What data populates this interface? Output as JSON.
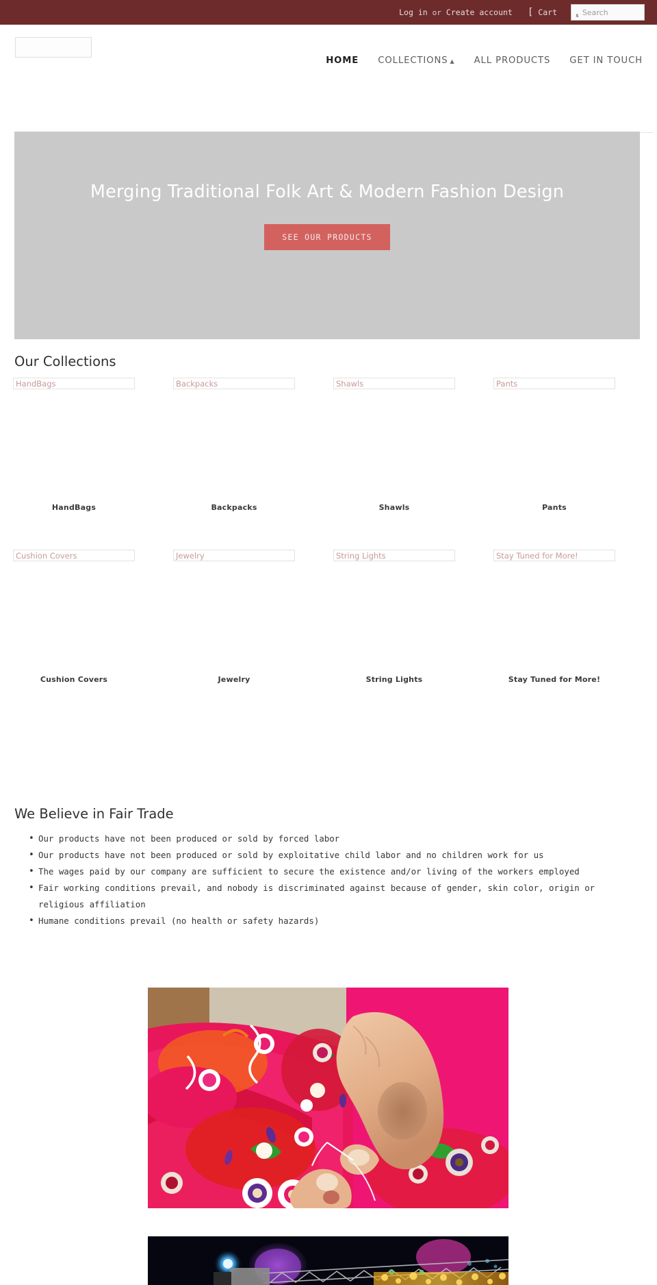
{
  "topbar": {
    "login_label": "Log in",
    "or_label": "or",
    "create_account_label": "Create account",
    "cart_icon": "cart-icon",
    "cart_glyph": "[",
    "cart_label": "Cart",
    "search_glyph": "s",
    "search_placeholder": "Search",
    "search_value": "",
    "background_color": "#6e2b2b"
  },
  "header": {
    "logo_alt": "",
    "nav": [
      {
        "label": "HOME",
        "active": true,
        "has_dropdown": false
      },
      {
        "label": "COLLECTIONS",
        "active": false,
        "has_dropdown": true,
        "caret": "▲"
      },
      {
        "label": "ALL PRODUCTS",
        "active": false,
        "has_dropdown": false
      },
      {
        "label": "GET IN TOUCH",
        "active": false,
        "has_dropdown": false
      }
    ]
  },
  "hero": {
    "title": "Merging Traditional Folk Art & Modern Fashion Design",
    "button_label": "SEE OUR PRODUCTS",
    "background_color": "#c9c9c9",
    "button_color": "#d3625f"
  },
  "collections": {
    "section_title": "Our Collections",
    "rows": [
      [
        {
          "alt": "HandBags",
          "label": "HandBags"
        },
        {
          "alt": "Backpacks",
          "label": "Backpacks"
        },
        {
          "alt": "Shawls",
          "label": "Shawls"
        },
        {
          "alt": "Pants",
          "label": "Pants"
        }
      ],
      [
        {
          "alt": "Cushion Covers",
          "label": "Cushion Covers"
        },
        {
          "alt": "Jewelry",
          "label": "Jewelry"
        },
        {
          "alt": "String Lights",
          "label": "String Lights"
        },
        {
          "alt": "Stay Tuned for More!",
          "label": "Stay Tuned for More!"
        }
      ]
    ]
  },
  "fair_trade": {
    "section_title": "We Believe in Fair Trade",
    "bullets": [
      "Our products have not been produced or sold by forced labor",
      "Our products have not been produced or sold by exploitative child labor and no children work for us",
      "The wages paid by our company are sufficient to secure the existence and/or living of the workers employed",
      "Fair working conditions prevail, and nobody is discriminated against because of gender, skin color, origin or religious affiliation",
      "Humane conditions prevail (no health or safety hazards)"
    ]
  },
  "photos": [
    {
      "name": "embroidery-photo",
      "description": "Hands stitching colorful pink and red folk embroidery"
    },
    {
      "name": "festival-photo",
      "description": "Night scene with stage lighting and colorful lit decorations"
    }
  ]
}
